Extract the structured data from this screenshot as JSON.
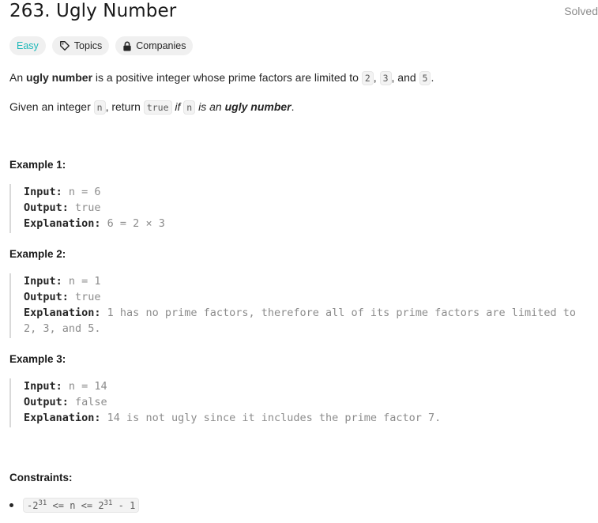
{
  "problem": {
    "title": "263. Ugly Number",
    "status": "Solved",
    "difficulty": "Easy",
    "tags": [
      "Topics",
      "Companies"
    ]
  },
  "description": {
    "p1_a": "An ",
    "p1_bold": "ugly number",
    "p1_b": " is a positive integer whose prime factors are limited to ",
    "p1_c1": "2",
    "p1_sep1": ", ",
    "p1_c2": "3",
    "p1_sep2": ", and ",
    "p1_c3": "5",
    "p1_end": ".",
    "p2_a": "Given an integer ",
    "p2_c1": "n",
    "p2_b": ", return ",
    "p2_c2": "true",
    "p2_if": " if ",
    "p2_c3": "n",
    "p2_isan": " is an ",
    "p2_bold": "ugly number",
    "p2_end": "."
  },
  "examples": [
    {
      "title": "Example 1:",
      "input_label": "Input:",
      "input": " n = 6",
      "output_label": "Output:",
      "output": " true",
      "explanation_label": "Explanation:",
      "explanation": " 6 = 2 × 3"
    },
    {
      "title": "Example 2:",
      "input_label": "Input:",
      "input": " n = 1",
      "output_label": "Output:",
      "output": " true",
      "explanation_label": "Explanation:",
      "explanation": " 1 has no prime factors, therefore all of its prime factors are limited to\n2, 3, and 5."
    },
    {
      "title": "Example 3:",
      "input_label": "Input:",
      "input": " n = 14",
      "output_label": "Output:",
      "output": " false",
      "explanation_label": "Explanation:",
      "explanation": " 14 is not ugly since it includes the prime factor 7."
    }
  ],
  "constraints": {
    "title": "Constraints:",
    "c1_a": "-2",
    "c1_sup1": "31",
    "c1_b": " <= n <= 2",
    "c1_sup2": "31",
    "c1_c": " - 1"
  }
}
